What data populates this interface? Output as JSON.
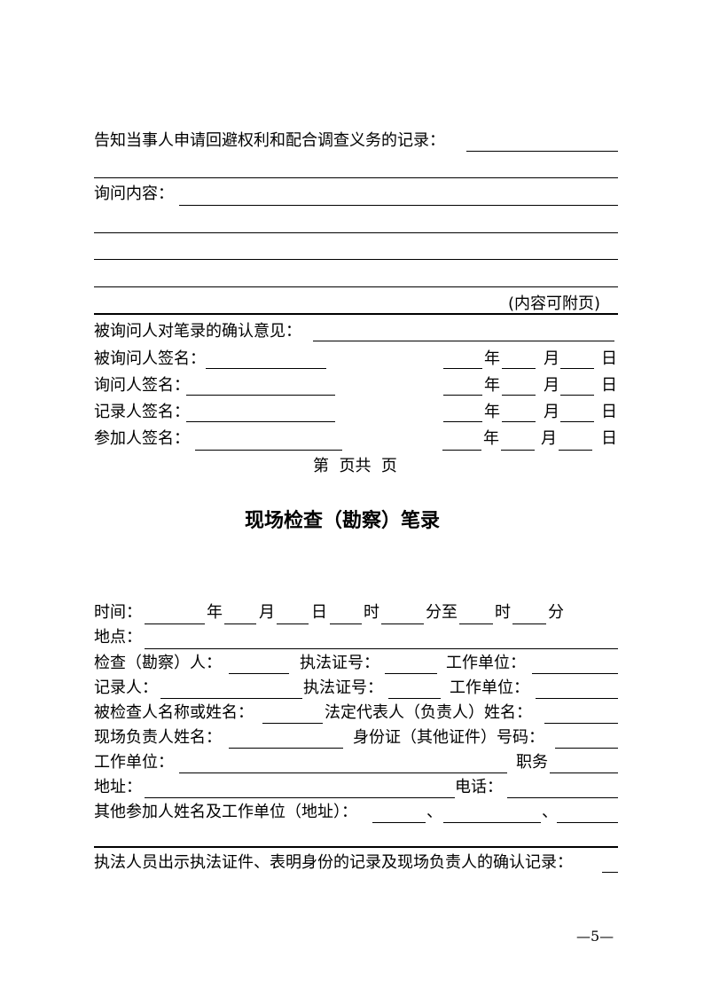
{
  "part1": {
    "notice_label": "告知当事人申请回避权利和配合调查义务的记录：",
    "inquiry_label": "询问内容：",
    "attach_note": "(内容可附页)",
    "confirm_label": "被询问人对笔录的确认意见：",
    "signatures": [
      {
        "label": "被询问人签名：",
        "year": "年",
        "month": "月",
        "day": "日"
      },
      {
        "label": "询问人签名：",
        "year": "年",
        "month": "月",
        "day": "日"
      },
      {
        "label": "记录人签名：",
        "year": "年",
        "month": "月",
        "day": "日"
      },
      {
        "label": "参加人签名：",
        "year": "年",
        "month": "月",
        "day": "日"
      }
    ],
    "page_indicator": "第  页共  页"
  },
  "part2": {
    "title": "现场检查（勘察）笔录",
    "time": {
      "label": "时间：",
      "year": "年",
      "month": "月",
      "day": "日",
      "hour": "时",
      "minute_to": "分至",
      "hour2": "时",
      "minute2": "分"
    },
    "place_label": "地点：",
    "inspector_label": "检查（勘察）人：",
    "license_label_1": "执法证号：",
    "unit_label_1": "工作单位：",
    "recorder_label": "记录人：",
    "license_label_2": "执法证号：",
    "unit_label_2": "工作单位：",
    "inspected_name_label": "被检查人名称或姓名：",
    "legal_rep_label": "法定代表人（负责人）姓名：",
    "onsite_person_label": "现场负责人姓名：",
    "id_label": "身份证（其他证件）号码：",
    "work_unit_label": "工作单位：",
    "position_label": "职务",
    "address_label": "地址：",
    "phone_label": "电话：",
    "others_label": "其他参加人姓名及工作单位（地址）：",
    "separator": "、",
    "show_id_label": "执法人员出示执法证件、表明身份的记录及现场负责人的确认记录："
  },
  "footer": {
    "page_number": "—5—"
  }
}
